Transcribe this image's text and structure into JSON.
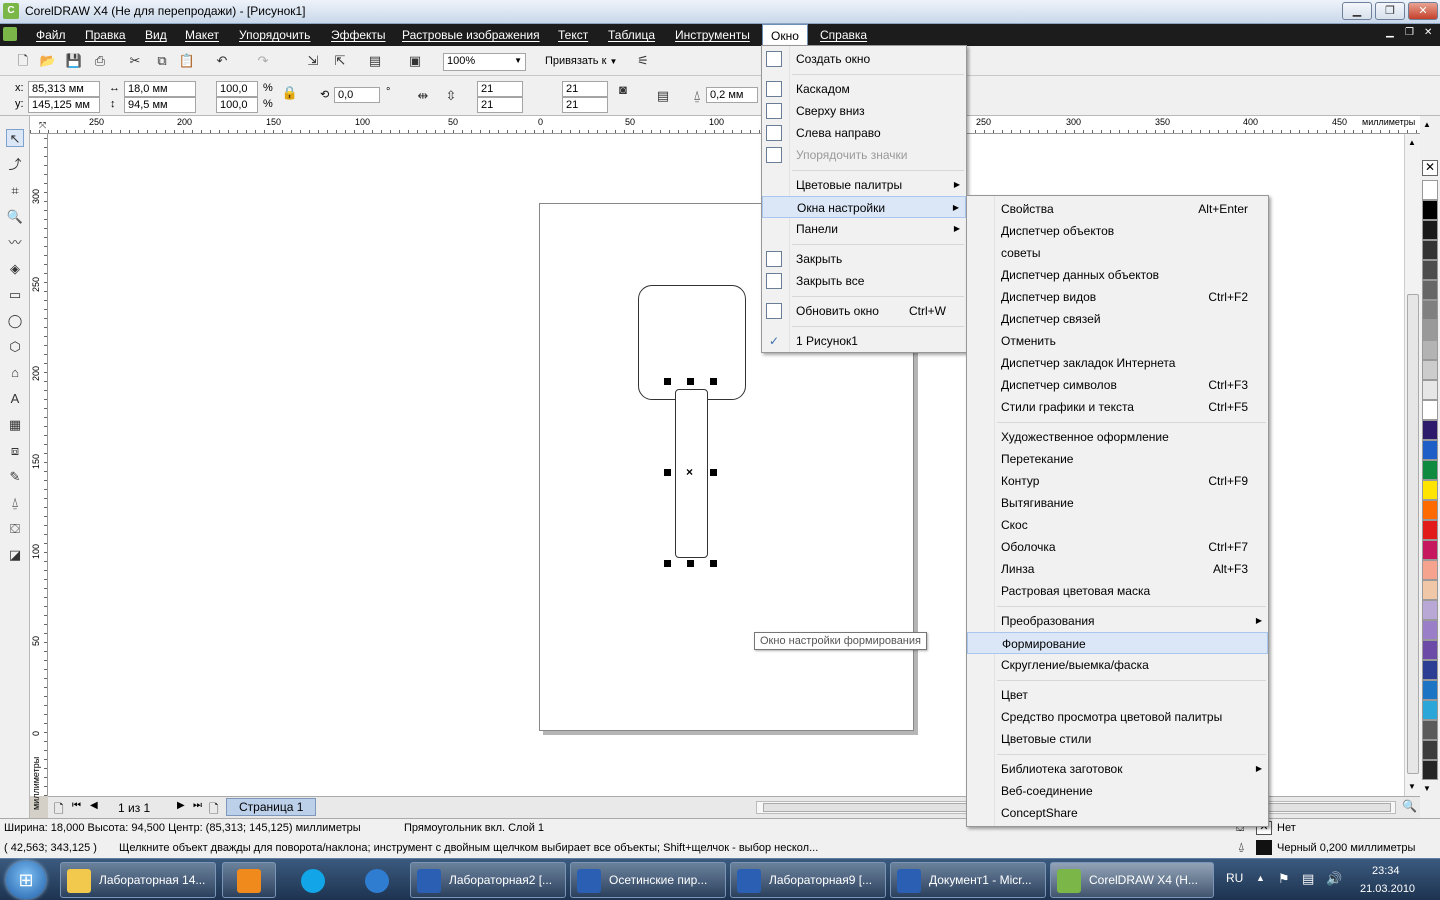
{
  "window": {
    "title": "CorelDRAW X4 (Не для перепродажи) - [Рисунок1]",
    "min": "▁",
    "max": "❐",
    "close": "✕"
  },
  "menubar": {
    "items": [
      "Файл",
      "Правка",
      "Вид",
      "Макет",
      "Упорядочить",
      "Эффекты",
      "Растровые изображения",
      "Текст",
      "Таблица",
      "Инструменты",
      "Окно",
      "Справка"
    ],
    "active_index": 10
  },
  "toolbar": {
    "zoom": "100%",
    "snap": "Привязать к"
  },
  "property_bar": {
    "x_label": "x:",
    "x": "85,313 мм",
    "y_label": "y:",
    "y": "145,125 мм",
    "w": "18,0 мм",
    "h": "94,5 мм",
    "sx": "100,0",
    "sy": "100,0",
    "pct": "%",
    "angle": "0,0",
    "deg": "°",
    "c1": "21",
    "c2": "21",
    "c3": "21",
    "c4": "21",
    "outline": "0,2 мм"
  },
  "rulers": {
    "h_ticks": [
      "250",
      "200",
      "150",
      "100",
      "50",
      "0",
      "50",
      "100",
      "150",
      "200",
      "250",
      "300",
      "350",
      "400",
      "450"
    ],
    "h_unit": "миллиметры",
    "v_ticks": [
      "300",
      "250",
      "200",
      "150",
      "100",
      "50",
      "0"
    ],
    "v_unit": "миллиметры"
  },
  "okno_menu": {
    "items": [
      {
        "label": "Создать окно",
        "shortcut": "",
        "arrow": false,
        "icon": true
      },
      {
        "sep": true
      },
      {
        "label": "Каскадом",
        "icon": true
      },
      {
        "label": "Сверху вниз",
        "icon": true
      },
      {
        "label": "Слева направо",
        "icon": true
      },
      {
        "label": "Упорядочить значки",
        "disabled": true,
        "icon": true
      },
      {
        "sep": true
      },
      {
        "label": "Цветовые палитры",
        "arrow": true
      },
      {
        "label": "Окна настройки",
        "arrow": true,
        "highlight": true
      },
      {
        "label": "Панели",
        "arrow": true
      },
      {
        "sep": true
      },
      {
        "label": "Закрыть",
        "icon": true
      },
      {
        "label": "Закрыть все",
        "icon": true
      },
      {
        "sep": true
      },
      {
        "label": "Обновить окно",
        "shortcut": "Ctrl+W",
        "icon": true
      },
      {
        "sep": true
      },
      {
        "label": "1 Рисунок1",
        "check": "✓"
      }
    ]
  },
  "submenu": {
    "items": [
      {
        "label": "Свойства",
        "shortcut": "Alt+Enter"
      },
      {
        "label": "Диспетчер объектов"
      },
      {
        "label": "советы"
      },
      {
        "label": "Диспетчер данных объектов"
      },
      {
        "label": "Диспетчер видов",
        "shortcut": "Ctrl+F2"
      },
      {
        "label": "Диспетчер связей"
      },
      {
        "label": "Отменить"
      },
      {
        "label": "Диспетчер закладок Интернета"
      },
      {
        "label": "Диспетчер символов",
        "shortcut": "Ctrl+F3"
      },
      {
        "label": "Стили графики и текста",
        "shortcut": "Ctrl+F5"
      },
      {
        "sep": true
      },
      {
        "label": "Художественное оформление"
      },
      {
        "label": "Перетекание"
      },
      {
        "label": "Контур",
        "shortcut": "Ctrl+F9"
      },
      {
        "label": "Вытягивание"
      },
      {
        "label": "Скос"
      },
      {
        "label": "Оболочка",
        "shortcut": "Ctrl+F7"
      },
      {
        "label": "Линза",
        "shortcut": "Alt+F3"
      },
      {
        "label": "Растровая цветовая маска"
      },
      {
        "sep": true
      },
      {
        "label": "Преобразования",
        "arrow": true
      },
      {
        "label": "Формирование",
        "highlight": true
      },
      {
        "label": "Скругление/выемка/фаска"
      },
      {
        "sep": true
      },
      {
        "label": "Цвет"
      },
      {
        "label": "Средство просмотра цветовой палитры"
      },
      {
        "label": "Цветовые стили"
      },
      {
        "sep": true
      },
      {
        "label": "Библиотека заготовок",
        "arrow": true
      },
      {
        "label": "Веб-соединение"
      },
      {
        "label": "ConceptShare"
      }
    ]
  },
  "tooltip": "Окно настройки формирования",
  "pagebar": {
    "counter": "1 из 1",
    "page_tab": "Страница 1"
  },
  "status": {
    "line1": "Ширина: 18,000  Высота: 94,500  Центр: (85,313; 145,125)  миллиметры",
    "layer": "Прямоугольник вкл. Слой 1",
    "coords": "( 42,563; 343,125 )",
    "hint": "Щелкните объект дважды для поворота/наклона; инструмент с двойным щелчком выбирает все объекты; Shift+щелчок - выбор нескол...",
    "fill": "Нет",
    "outline": "Черный  0,200 миллиметры"
  },
  "taskbar": {
    "tasks": [
      "Лабораторная 14...",
      "",
      "",
      "",
      "Лабораторная2 [...",
      "Осетинские пир...",
      "Лабораторная9 [...",
      "Документ1 - Micr...",
      "CorelDRAW X4 (Н..."
    ],
    "lang": "RU",
    "time": "23:34",
    "date": "21.03.2010"
  },
  "palette_colors": [
    "#ffffff",
    "#000000",
    "#1a1a1a",
    "#333333",
    "#4d4d4d",
    "#666666",
    "#808080",
    "#999999",
    "#b3b3b3",
    "#cccccc",
    "#e6e6e6",
    "#ffffff",
    "#2e1a6b",
    "#1e5fc7",
    "#0f8a3e",
    "#ffe400",
    "#ff6a00",
    "#e21b1b",
    "#c5165e",
    "#f5a38e",
    "#f0c8a8",
    "#b9a7d6",
    "#9b7ec8",
    "#6c4aa8",
    "#2c3e93",
    "#1c74c4",
    "#2aa6d9",
    "#5a5a5a",
    "#3c3c3c",
    "#262626"
  ]
}
